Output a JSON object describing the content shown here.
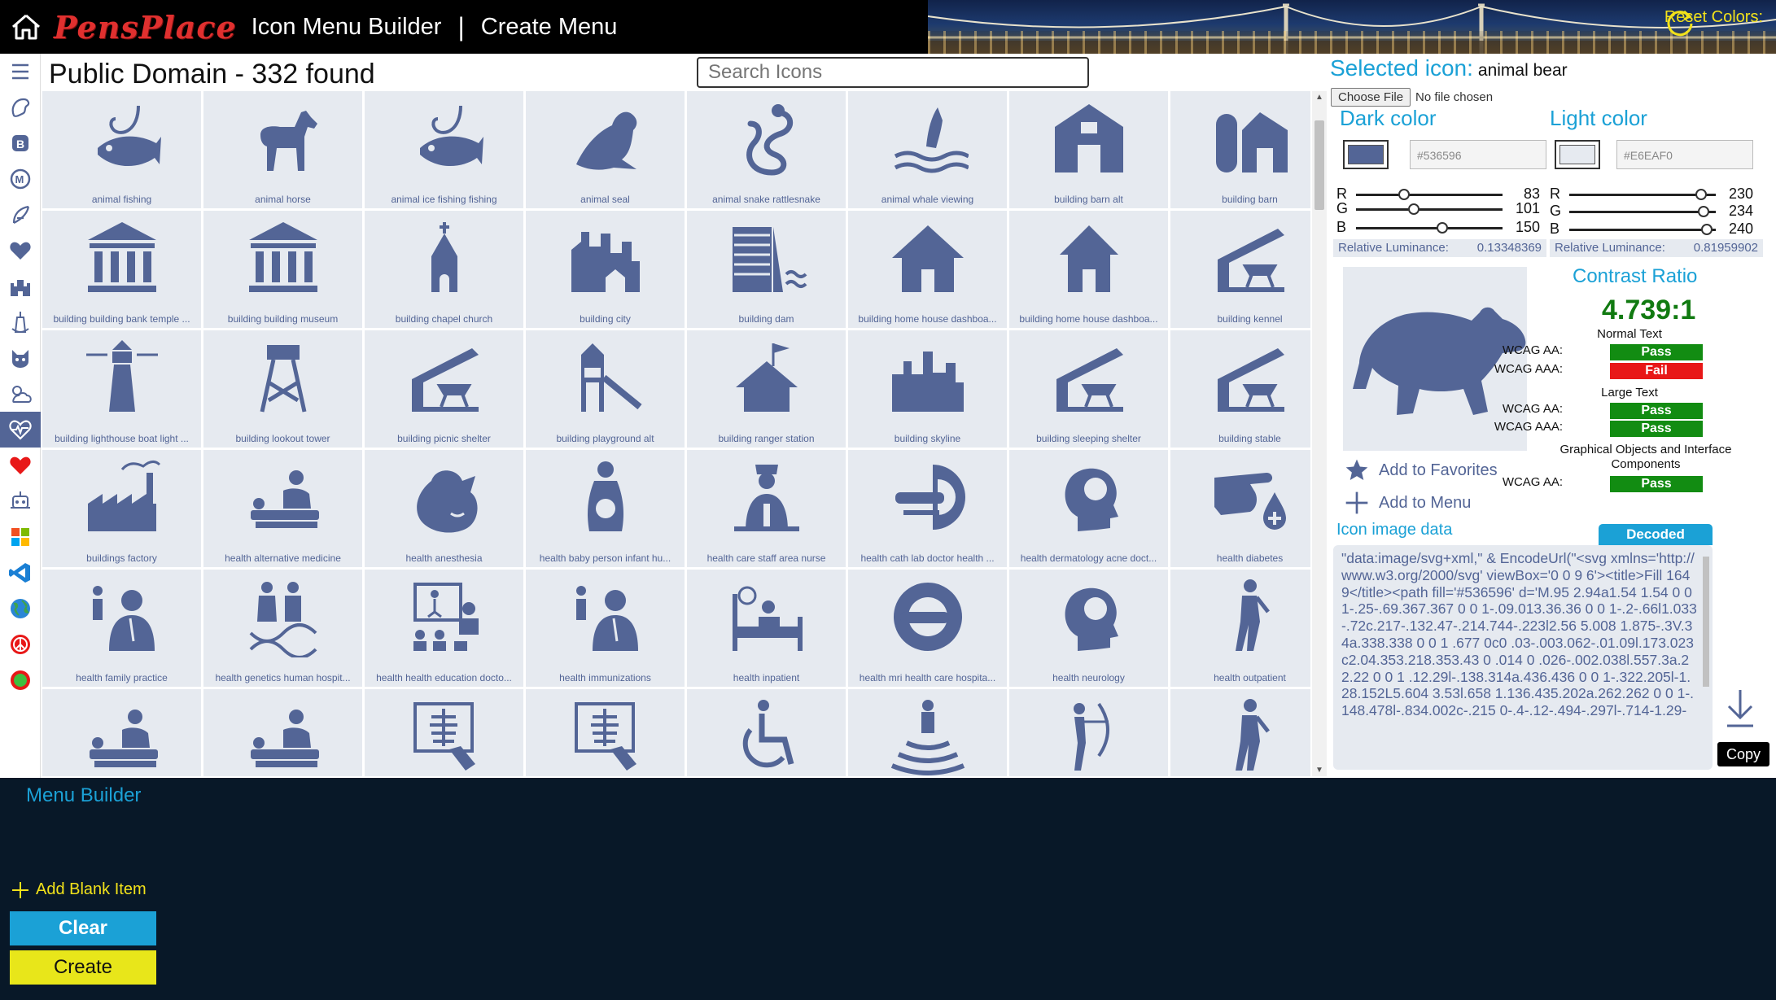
{
  "header": {
    "logo_text": "PensPlace",
    "app_title": "Icon Menu Builder",
    "separator": "|",
    "page_title": "Create Menu",
    "reset_label": "Reset Colors:"
  },
  "rail": {
    "items": [
      "menu-icon",
      "palette-icon",
      "bootstrap-icon",
      "material-icon",
      "feather-icon",
      "heart-icon",
      "castle-icon",
      "lighthouse-icon",
      "cat-icon",
      "weather-icon",
      "public-domain-icon",
      "red-heart-icon",
      "robot-icon",
      "windows-icon",
      "vscode-icon",
      "globe-icon",
      "peace-icon",
      "color-circle-icon"
    ],
    "active_index": 10
  },
  "grid": {
    "heading": "Public Domain - 332 found",
    "search_placeholder": "Search Icons",
    "tiles": [
      {
        "label": "animal fishing",
        "icon": "fish-hook"
      },
      {
        "label": "animal horse",
        "icon": "horse"
      },
      {
        "label": "animal ice fishing fishing",
        "icon": "fish-hook"
      },
      {
        "label": "animal seal",
        "icon": "seal"
      },
      {
        "label": "animal snake rattlesnake",
        "icon": "snake"
      },
      {
        "label": "animal whale viewing",
        "icon": "whale"
      },
      {
        "label": "building barn alt",
        "icon": "barn"
      },
      {
        "label": "building barn",
        "icon": "barn-silo"
      },
      {
        "label": "building building bank temple ...",
        "icon": "bank"
      },
      {
        "label": "building building museum",
        "icon": "bank"
      },
      {
        "label": "building chapel church",
        "icon": "chapel"
      },
      {
        "label": "building city",
        "icon": "city"
      },
      {
        "label": "building dam",
        "icon": "dam"
      },
      {
        "label": "building home house dashboa...",
        "icon": "house"
      },
      {
        "label": "building home house dashboa...",
        "icon": "house-narrow"
      },
      {
        "label": "building kennel",
        "icon": "shelter"
      },
      {
        "label": "building lighthouse boat light ...",
        "icon": "lighthouse"
      },
      {
        "label": "building lookout tower",
        "icon": "tower"
      },
      {
        "label": "building picnic shelter",
        "icon": "shelter"
      },
      {
        "label": "building playground alt",
        "icon": "playground"
      },
      {
        "label": "building ranger station",
        "icon": "house-flag"
      },
      {
        "label": "building skyline",
        "icon": "skyline"
      },
      {
        "label": "building sleeping shelter",
        "icon": "shelter"
      },
      {
        "label": "building stable",
        "icon": "shelter"
      },
      {
        "label": "buildings factory",
        "icon": "factory"
      },
      {
        "label": "health alternative medicine",
        "icon": "person-lying"
      },
      {
        "label": "health anesthesia",
        "icon": "anesthesia"
      },
      {
        "label": "health baby person infant hu...",
        "icon": "pregnant"
      },
      {
        "label": "health care staff area nurse",
        "icon": "nurse"
      },
      {
        "label": "health cath lab doctor health ...",
        "icon": "scanner"
      },
      {
        "label": "health dermatology acne doct...",
        "icon": "head"
      },
      {
        "label": "health diabetes",
        "icon": "finger"
      },
      {
        "label": "health family practice",
        "icon": "doctor"
      },
      {
        "label": "health genetics human hospit...",
        "icon": "family"
      },
      {
        "label": "health health education docto...",
        "icon": "education"
      },
      {
        "label": "health immunizations",
        "icon": "doctor"
      },
      {
        "label": "health inpatient",
        "icon": "bed"
      },
      {
        "label": "health mri health care hospita...",
        "icon": "mri"
      },
      {
        "label": "health neurology",
        "icon": "head"
      },
      {
        "label": "health outpatient",
        "icon": "walker"
      },
      {
        "label": "",
        "icon": "person-lying"
      },
      {
        "label": "",
        "icon": "person-lying"
      },
      {
        "label": "",
        "icon": "xray"
      },
      {
        "label": "",
        "icon": "xray"
      },
      {
        "label": "",
        "icon": "wheelchair"
      },
      {
        "label": "",
        "icon": "radiation"
      },
      {
        "label": "",
        "icon": "archer"
      },
      {
        "label": "",
        "icon": "walker"
      }
    ]
  },
  "panel": {
    "selected_label": "Selected icon:",
    "selected_name": "animal bear",
    "file_button": "Choose File",
    "file_status": "No file chosen",
    "dark": {
      "heading": "Dark color",
      "hex": "#536596",
      "r": 83,
      "g": 101,
      "b": 150,
      "lum_label": "Relative Luminance:",
      "lum_value": "0.13348369"
    },
    "light": {
      "heading": "Light color",
      "hex": "#E6EAF0",
      "r": 230,
      "g": 234,
      "b": 240,
      "lum_label": "Relative Luminance:",
      "lum_value": "0.81959902"
    },
    "channels": {
      "r": "R",
      "g": "G",
      "b": "B"
    },
    "contrast": {
      "heading": "Contrast Ratio",
      "ratio": "4.739:1",
      "normal_text": "Normal Text",
      "large_text": "Large Text",
      "graphical": "Graphical Objects and Interface Components",
      "aa_label": "WCAG AA:",
      "aaa_label": "WCAG AAA:",
      "normal_aa": "Pass",
      "normal_aaa": "Fail",
      "large_aa": "Pass",
      "large_aaa": "Pass",
      "graphical_aa": "Pass"
    },
    "add_favorites": "Add to Favorites",
    "add_menu": "Add to Menu",
    "image_data_heading": "Icon image data",
    "decoded_tab": "Decoded",
    "image_data": "\"data:image/svg+xml,\" & EncodeUrl(\"<svg xmlns='http://www.w3.org/2000/svg' viewBox='0 0 9 6'><title>Fill 1649</title><path fill='#536596' d='M.95 2.94a1.54 1.54 0 0 1-.25-.69.367.367 0 0 1-.09.013.36.36 0 0 1-.2-.66l1.033-.72c.217-.132.47-.214.744-.223l2.56 5.008 1.875-.3V.34a.338.338 0 0 1 .677 0c0 .03-.003.062-.01.09l.173.023c2.04.353.218.353.43 0 .014 0 .026-.002.038l.557.3a.22.22 0 0 1 .12.29l-.138.314a.436.436 0 0 1-.322.205l-1.28.152L5.604 3.53l.658 1.136.435.202a.262.262 0 0 1-.148.478l-.834.002c-.215 0-.4-.12-.494-.297l-.714-1.29-",
    "copy_label": "Copy"
  },
  "bottom": {
    "title": "Menu Builder",
    "add_blank": "Add Blank Item",
    "clear_label": "Clear",
    "create_label": "Create"
  },
  "colors": {
    "dark": "#536596",
    "light": "#E6EAF0",
    "accent": "#1ba1d6",
    "yellow": "#f2e21a",
    "pass": "#128c12",
    "fail": "#e81818"
  }
}
